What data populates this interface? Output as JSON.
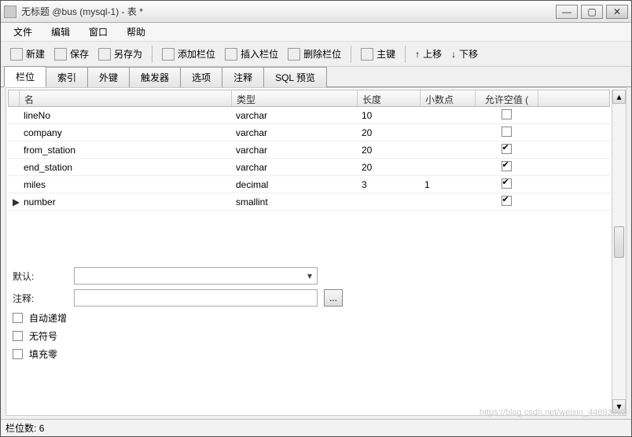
{
  "window": {
    "title": "无标题 @bus (mysql-1) - 表 *"
  },
  "menu": {
    "file": "文件",
    "edit": "编辑",
    "window": "窗口",
    "help": "帮助"
  },
  "toolbar": {
    "new": "新建",
    "save": "保存",
    "saveas": "另存为",
    "addfield": "添加栏位",
    "insertfield": "插入栏位",
    "deletefield": "删除栏位",
    "primarykey": "主键",
    "moveup": "上移",
    "movedown": "下移"
  },
  "tabs": {
    "fields": "栏位",
    "indexes": "索引",
    "fks": "外键",
    "triggers": "触发器",
    "options": "选项",
    "comment": "注释",
    "sqlpreview": "SQL 预览"
  },
  "grid": {
    "headers": {
      "name": "名",
      "type": "类型",
      "length": "长度",
      "decimals": "小数点",
      "allownull": "允许空值 ("
    },
    "rows": [
      {
        "name": "lineNo",
        "type": "varchar",
        "length": "10",
        "decimals": "",
        "allownull": false,
        "current": false
      },
      {
        "name": "company",
        "type": "varchar",
        "length": "20",
        "decimals": "",
        "allownull": false,
        "current": false
      },
      {
        "name": "from_station",
        "type": "varchar",
        "length": "20",
        "decimals": "",
        "allownull": true,
        "current": false
      },
      {
        "name": "end_station",
        "type": "varchar",
        "length": "20",
        "decimals": "",
        "allownull": true,
        "current": false
      },
      {
        "name": "miles",
        "type": "decimal",
        "length": "3",
        "decimals": "1",
        "allownull": true,
        "current": false
      },
      {
        "name": "number",
        "type": "smallint",
        "length": "",
        "decimals": "",
        "allownull": true,
        "current": true
      }
    ]
  },
  "props": {
    "default_label": "默认:",
    "default_value": "",
    "comment_label": "注释:",
    "comment_value": "",
    "autoinc_label": "自动递增",
    "autoinc": false,
    "unsigned_label": "无符号",
    "unsigned": false,
    "zerofill_label": "填充零",
    "zerofill": false,
    "dots": "..."
  },
  "status": {
    "fieldcount_label": "栏位数:",
    "fieldcount_value": "6"
  },
  "watermark": "https://blog.csdn.net/weixin_44893902"
}
